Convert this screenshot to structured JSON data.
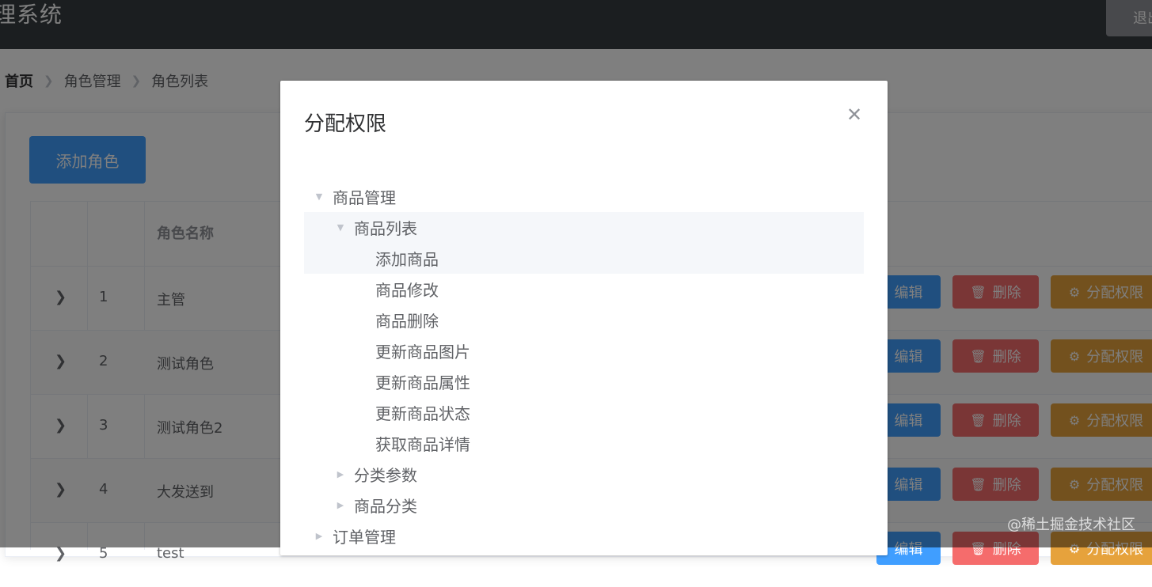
{
  "header": {
    "title": "理系统",
    "logout_label": "退出"
  },
  "breadcrumb": [
    "首页",
    "角色管理",
    "角色列表"
  ],
  "toolbar": {
    "add_role_label": "添加角色"
  },
  "table": {
    "columns": {
      "name": "角色名称"
    },
    "rows": [
      {
        "index": "1",
        "name": "主管"
      },
      {
        "index": "2",
        "name": "测试角色"
      },
      {
        "index": "3",
        "name": "测试角色2"
      },
      {
        "index": "4",
        "name": "大发送到"
      },
      {
        "index": "5",
        "name": "test"
      }
    ],
    "actions": {
      "edit": "编辑",
      "delete": "删除",
      "assign": "分配权限"
    }
  },
  "dialog": {
    "title": "分配权限",
    "tree": [
      {
        "label": "商品管理",
        "state": "expanded"
      },
      {
        "label": "商品列表",
        "state": "expanded"
      },
      {
        "label": "添加商品",
        "state": "leaf"
      },
      {
        "label": "商品修改",
        "state": "leaf"
      },
      {
        "label": "商品删除",
        "state": "leaf"
      },
      {
        "label": "更新商品图片",
        "state": "leaf"
      },
      {
        "label": "更新商品属性",
        "state": "leaf"
      },
      {
        "label": "更新商品状态",
        "state": "leaf"
      },
      {
        "label": "获取商品详情",
        "state": "leaf"
      },
      {
        "label": "分类参数",
        "state": "collapsed"
      },
      {
        "label": "商品分类",
        "state": "collapsed"
      },
      {
        "label": "订单管理",
        "state": "collapsed"
      }
    ]
  },
  "watermark": "@稀土掘金技术社区",
  "colors": {
    "header_bg": "#373d41",
    "primary": "#409eff",
    "danger": "#f56c6c",
    "warning": "#e6a23c",
    "tree_highlight": "#f5f7fa"
  },
  "icons": {
    "expand": "chevron-right-icon",
    "delete": "trash-icon",
    "assign": "gear-icon",
    "close": "close-icon",
    "tree_expanded": "caret-down-icon",
    "tree_collapsed": "caret-right-icon"
  }
}
